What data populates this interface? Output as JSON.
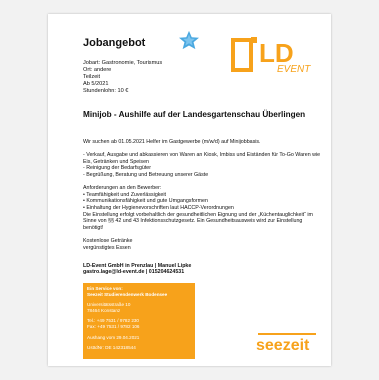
{
  "job": {
    "title": "Jobangebot",
    "meta": [
      "Jobart: Gastronomie, Tourismus",
      "Ort: andere",
      "Teilzeit",
      "Ab 5/2021",
      "Stundenlohn: 10 €"
    ],
    "headline": "Minijob - Aushilfe auf der Landesgartenschau Überlingen",
    "intro": "Wir suchen ab 01.05.2021 Helfer im Gastgewerbe (m/w/d) auf Minijobbasis.",
    "tasks": [
      "- Verkauf, Ausgabe und abkassieren von Waren an Kiosk, Imbiss und Eiständen für To-Go Waren wie Eis, Getränken und Speisen",
      "- Reinigung der Bedarfsgüter",
      "- Begrüßung, Beratung und Betreuung unserer Gäste"
    ],
    "requirements_heading": "Anforderungen an den Bewerber:",
    "requirements": [
      "• Teamfähigkeit und Zuverlässigkeit",
      "• Kommunikationsfähigkeit und gute Umgangsformen",
      "• Einhaltung der Hygienevorschriften laut HACCP-Verordnungen",
      "Die Einstellung erfolgt vorbehaltlich der gesundheitlichen Eignung und der „Küchentauglichkeit“ im Sinne von §§ 42 und 43 Infektionsschutzgesetz. Ein Gesundheitsausweis wird zur Einstellung benötigt!"
    ],
    "benefits": [
      "Kostenlose Getränke",
      "vergünstigtes Essen"
    ],
    "contact": [
      "LD-Event GmbH in Prenzlau | Manuel Lipke",
      "gastro.lage@ld-event.de | 015204624531"
    ]
  },
  "logo": {
    "letters": "LD",
    "word": "EVENT",
    "color": "#f7a21b"
  },
  "service": {
    "heading": "Ein Service von:",
    "org": "Seezeit Studierendenwerk Bodensee",
    "address": [
      "Universitätsstraße 10",
      "78464 Konstanz"
    ],
    "phone": [
      "Tel.: +49 7531 / 9782 230",
      "Fax: +49 7531 / 9782 106"
    ],
    "posted": "Aushang vom 29.04.2021",
    "id": "UstIdNr: DE 142318544",
    "color": "#f7a21b"
  },
  "seezeit_logo": {
    "text": "seezeit",
    "color": "#f7a21b"
  },
  "star_color": "#4aa8e0"
}
